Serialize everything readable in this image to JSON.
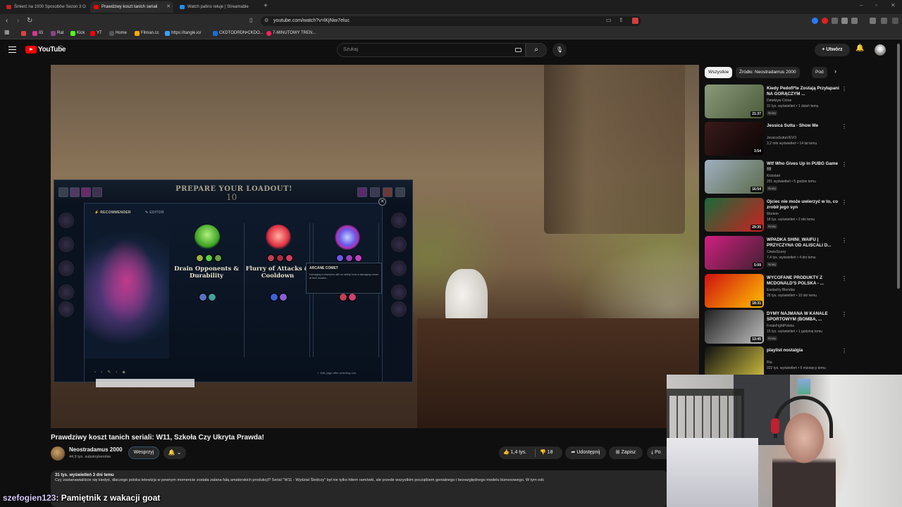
{
  "browser": {
    "tabs": [
      {
        "title": "Śmierć na 1000 Sposobów Sezon 3 O",
        "color": "#cc2020"
      },
      {
        "title": "Prawdziwy koszt tanich seriali",
        "color": "#ff0000"
      },
      {
        "title": "Watch patino reluje | Streamable",
        "color": "#1e8fff"
      }
    ],
    "new_tab": "+",
    "url": "youtube.com/watch?v=lKjNiw7eluc",
    "bookmarks": [
      {
        "label": "",
        "color": "#e04040"
      },
      {
        "label": "IG",
        "color": "#d03890"
      },
      {
        "label": "Rat",
        "color": "#884488"
      },
      {
        "label": "Kick",
        "color": "#53fc18"
      },
      {
        "label": "YT",
        "color": "#ff0000"
      },
      {
        "label": "Home",
        "color": "#555555"
      },
      {
        "label": "Filman.cc",
        "color": "#ffaa00"
      },
      {
        "label": "https://tangle.io/",
        "color": "#3aa0ff"
      },
      {
        "label": "CKDTODRDN•CKDO...",
        "color": "#1a6fd8"
      },
      {
        "label": "7-MINUTOWY TREN...",
        "color": "#ff2060"
      }
    ]
  },
  "youtube": {
    "brand": "YouTube",
    "country": "PL",
    "search_placeholder": "Szukaj",
    "create_label": "+ Utwórz"
  },
  "game_overlay": {
    "title": "PREPARE YOUR LOADOUT!",
    "timer": "10",
    "tab_recommender": "RECOMMENDER",
    "tab_editor": "EDITOR",
    "runes": [
      {
        "name": "Drain Opponents & Durability",
        "color": "#5ad040"
      },
      {
        "name": "Flurry of Attacks & Cooldown",
        "color": "#e04050"
      },
      {
        "name": "",
        "color": "#6a58e8"
      }
    ],
    "tooltip_title": "ARCANE COMET",
    "tooltip_desc": "Damaging a champion with an ability hurls a damaging comet at their location.",
    "edit_note": "Edit page after selecting one."
  },
  "video": {
    "title": "Prawdziwy koszt tanich seriali: W11, Szkoła Czy Ukryta Prawda!",
    "channel": "Neostradamus 2000",
    "subscribers": "44,9 tys. subskrybentów",
    "support_label": "Wesprzyj",
    "likes": "1,4 tys.",
    "dislikes": "18",
    "share_label": "Udostępnij",
    "save_label": "Zapisz",
    "download_label": "Po",
    "desc_meta": "31 tys. wyświetleń  3 dni temu",
    "desc_text": "Czy zastanawialiście się kiedyś, dlaczego polska telewizja w pewnym momencie została zalana falą amatorskich produkcji? Serial \"W11 - Wydział Śledczy\" był nie tylko hitem ramówki, ale przede wszystkim początkiem genialnego i bezwzględnego modelu biznesowego. W tym odc"
  },
  "sidebar": {
    "chips": [
      "Wszystkie",
      "Źródło: Neostradamus 2000",
      "Pod"
    ],
    "recommendations": [
      {
        "title": "Kiedy Pedofi*le Zostają Przyłapani NA GORĄCZYM ...",
        "channel": "Detektyw Crime",
        "meta": "31 tys. wyświetleń • 1 dzień temu",
        "badge": "Nowy",
        "duration": "21:37",
        "c1": "#8a9a7a",
        "c2": "#4a5a3a"
      },
      {
        "title": "Jessica Sutta - Show Me",
        "channel": "JessicaSuttaVEVO",
        "meta": "3,2 mln wyświetleń • 14 lat temu",
        "badge": "",
        "duration": "3:54",
        "c1": "#3a1a1a",
        "c2": "#0a0505"
      },
      {
        "title": "Wtf Who Gives Up in PUBG Game !!!",
        "channel": "Kickstart",
        "meta": "291 wyświetleń • 5 godzin temu",
        "badge": "Nowy",
        "duration": "16:54",
        "c1": "#a0b0c0",
        "c2": "#5a6a4a"
      },
      {
        "title": "Ojciec nie może uwierzyć w to, co zrobił jego syn",
        "channel": "Mortem",
        "meta": "18 tys. wyświetleń • 2 dni temu",
        "badge": "Nowy",
        "duration": "29:35",
        "c1": "#1a6a3a",
        "c2": "#cc2020"
      },
      {
        "title": "WPADKA SHINI_WAIFU | PRZYCZYNA OD ALISCALI D...",
        "channel": "CewisScozy",
        "meta": "7,4 tys. wyświetleń • 4 dni temu",
        "badge": "Nowy",
        "duration": "5:09",
        "c1": "#d02080",
        "c2": "#402030"
      },
      {
        "title": "WYCOFANE PRODUKTY Z MCDONALD'S POLSKA - ...",
        "channel": "Eustachy Blondas",
        "meta": "28 tys. wyświetleń • 10 dni temu",
        "badge": "",
        "duration": "18:31",
        "c1": "#d01010",
        "c2": "#ffc000"
      },
      {
        "title": "DYMY NAJMANA W KANALE SPORTOWYM (BOMBA, ...",
        "channel": "FreakFightPolska",
        "meta": "15 tys. wyświetleń • 1 godzinę temu",
        "badge": "Nowy",
        "duration": "13:45",
        "c1": "#202020",
        "c2": "#c0c0c0"
      },
      {
        "title": "playlist nostalgia",
        "channel": "Ria",
        "meta": "922 tys. wyświetleń • 6 miesięcy temu",
        "badge": "",
        "duration": "",
        "c1": "#101010",
        "c2": "#d0c040"
      }
    ]
  },
  "chat": {
    "user": "szefogien123",
    "message": ": Pamiętnik z wakacji goat"
  }
}
